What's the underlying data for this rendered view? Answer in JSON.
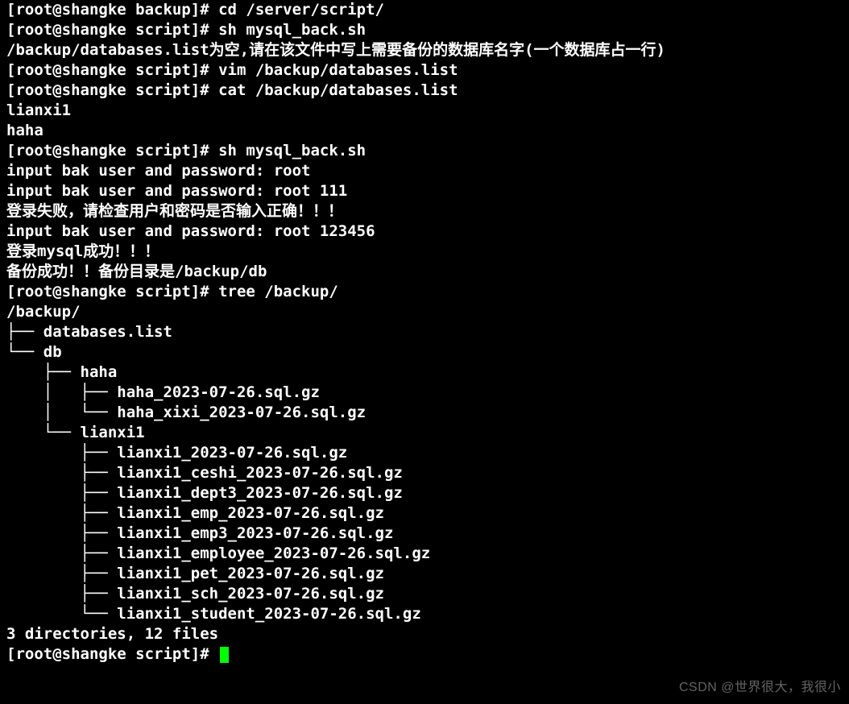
{
  "prompt_prefix": "[root@shangke ",
  "prompt_suffix": "]# ",
  "lines": [
    {
      "type": "prompt",
      "dir": "backup",
      "cmd": "cd /server/script/"
    },
    {
      "type": "prompt",
      "dir": "script",
      "cmd": "sh mysql_back.sh"
    },
    {
      "type": "output",
      "text": "/backup/databases.list为空,请在该文件中写上需要备份的数据库名字(一个数据库占一行)"
    },
    {
      "type": "prompt",
      "dir": "script",
      "cmd": "vim /backup/databases.list"
    },
    {
      "type": "prompt",
      "dir": "script",
      "cmd": "cat /backup/databases.list"
    },
    {
      "type": "output",
      "text": "lianxi1"
    },
    {
      "type": "output",
      "text": "haha"
    },
    {
      "type": "prompt",
      "dir": "script",
      "cmd": "sh mysql_back.sh"
    },
    {
      "type": "output",
      "text": "input bak user and password: root"
    },
    {
      "type": "output",
      "text": "input bak user and password: root 111"
    },
    {
      "type": "output",
      "text": "登录失败，请检查用户和密码是否输入正确！！！"
    },
    {
      "type": "output",
      "text": "input bak user and password: root 123456"
    },
    {
      "type": "output",
      "text": "登录mysql成功！！！"
    },
    {
      "type": "output",
      "text": "备份成功！！备份目录是/backup/db"
    },
    {
      "type": "prompt",
      "dir": "script",
      "cmd": "tree /backup/"
    },
    {
      "type": "output",
      "text": "/backup/"
    },
    {
      "type": "output",
      "text": "├── databases.list"
    },
    {
      "type": "output",
      "text": "└── db"
    },
    {
      "type": "output",
      "text": "    ├── haha"
    },
    {
      "type": "output",
      "text": "    │   ├── haha_2023-07-26.sql.gz"
    },
    {
      "type": "output",
      "text": "    │   └── haha_xixi_2023-07-26.sql.gz"
    },
    {
      "type": "output",
      "text": "    └── lianxi1"
    },
    {
      "type": "output",
      "text": "        ├── lianxi1_2023-07-26.sql.gz"
    },
    {
      "type": "output",
      "text": "        ├── lianxi1_ceshi_2023-07-26.sql.gz"
    },
    {
      "type": "output",
      "text": "        ├── lianxi1_dept3_2023-07-26.sql.gz"
    },
    {
      "type": "output",
      "text": "        ├── lianxi1_emp_2023-07-26.sql.gz"
    },
    {
      "type": "output",
      "text": "        ├── lianxi1_emp3_2023-07-26.sql.gz"
    },
    {
      "type": "output",
      "text": "        ├── lianxi1_employee_2023-07-26.sql.gz"
    },
    {
      "type": "output",
      "text": "        ├── lianxi1_pet_2023-07-26.sql.gz"
    },
    {
      "type": "output",
      "text": "        ├── lianxi1_sch_2023-07-26.sql.gz"
    },
    {
      "type": "output",
      "text": "        └── lianxi1_student_2023-07-26.sql.gz"
    },
    {
      "type": "output",
      "text": ""
    },
    {
      "type": "output",
      "text": "3 directories, 12 files"
    },
    {
      "type": "prompt",
      "dir": "script",
      "cmd": "",
      "cursor": true
    }
  ],
  "watermark": "CSDN @世界很大，我很小"
}
